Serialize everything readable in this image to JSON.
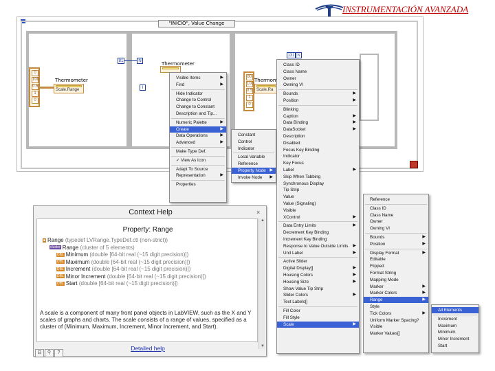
{
  "header": {
    "title": "INSTRUMENTACIÓN AVANZADA"
  },
  "diagram": {
    "case_label": "\"INICIO\", Value Change",
    "thermometer1_label": "Thermometer",
    "thermometer1_node": "Scale.Range",
    "thermometer2_label": "Thermometer",
    "thermometer3_label": "Thermometer",
    "thermometer3_node": "Scale.Ra",
    "array1_values": [
      "0",
      "100",
      "0.5",
      "1",
      "0"
    ],
    "array3_values": [
      "80",
      "100",
      "0.5",
      "1",
      "0"
    ],
    "num_81": "81",
    "num_131": "131"
  },
  "menu1": {
    "items": [
      {
        "label": "Visible Items",
        "arrow": true
      },
      {
        "label": "Find",
        "arrow": true
      },
      {
        "label": "Hide Indicator",
        "arrow": false
      },
      {
        "label": "Change to Control",
        "arrow": false
      },
      {
        "label": "Change to Constant",
        "arrow": false
      },
      {
        "label": "Description and Tip...",
        "arrow": false
      },
      {
        "label": "Numeric Palette",
        "arrow": true
      },
      {
        "label": "Create",
        "arrow": true
      },
      {
        "label": "Data Operations",
        "arrow": true
      },
      {
        "label": "Advanced",
        "arrow": true
      },
      {
        "label": "Make Type Def.",
        "arrow": false
      },
      {
        "label": "✓ View As Icon",
        "arrow": false
      },
      {
        "label": "Adapt To Source",
        "arrow": false
      },
      {
        "label": "Representation",
        "arrow": true
      },
      {
        "label": "Properties",
        "arrow": false
      }
    ]
  },
  "menu2": {
    "items": [
      {
        "label": "Constant",
        "arrow": false
      },
      {
        "label": "Control",
        "arrow": false
      },
      {
        "label": "Indicator",
        "arrow": false
      },
      {
        "label": "Local Variable",
        "arrow": false
      },
      {
        "label": "Reference",
        "arrow": false
      },
      {
        "label": "Property Node",
        "arrow": true
      },
      {
        "label": "Invoke Node",
        "arrow": true
      }
    ]
  },
  "menu3": {
    "items": [
      {
        "label": "Class ID",
        "arrow": false
      },
      {
        "label": "Class Name",
        "arrow": false
      },
      {
        "label": "Owner",
        "arrow": false
      },
      {
        "label": "Owning VI",
        "arrow": false
      },
      {
        "label": "Bounds",
        "arrow": true
      },
      {
        "label": "Position",
        "arrow": true
      },
      {
        "label": "Blinking",
        "arrow": false
      },
      {
        "label": "Caption",
        "arrow": true
      },
      {
        "label": "Data Binding",
        "arrow": true
      },
      {
        "label": "DataSocket",
        "arrow": true
      },
      {
        "label": "Description",
        "arrow": false
      },
      {
        "label": "Disabled",
        "arrow": false
      },
      {
        "label": "Focus Key Binding",
        "arrow": false
      },
      {
        "label": "Indicator",
        "arrow": false
      },
      {
        "label": "Key Focus",
        "arrow": false
      },
      {
        "label": "Label",
        "arrow": true
      },
      {
        "label": "Skip When Tabbing",
        "arrow": false
      },
      {
        "label": "Synchronous Display",
        "arrow": false
      },
      {
        "label": "Tip Strip",
        "arrow": false
      },
      {
        "label": "Value",
        "arrow": false
      },
      {
        "label": "Value (Signaling)",
        "arrow": false
      },
      {
        "label": "Visible",
        "arrow": false
      },
      {
        "label": "XControl",
        "arrow": true
      },
      {
        "label": "Data Entry Limits",
        "arrow": true
      },
      {
        "label": "Decrement Key Binding",
        "arrow": false
      },
      {
        "label": "Increment Key Binding",
        "arrow": false
      },
      {
        "label": "Response to Value Outside Limits",
        "arrow": true
      },
      {
        "label": "Unit Label",
        "arrow": true
      },
      {
        "label": "Active Slider",
        "arrow": false
      },
      {
        "label": "Digital Display[]",
        "arrow": true
      },
      {
        "label": "Housing Colors",
        "arrow": true
      },
      {
        "label": "Housing Size",
        "arrow": true
      },
      {
        "label": "Show Value Tip Strip",
        "arrow": false
      },
      {
        "label": "Slider Colors",
        "arrow": true
      },
      {
        "label": "Text Labels[]",
        "arrow": false
      },
      {
        "label": "Fill Color",
        "arrow": false
      },
      {
        "label": "Fill Style",
        "arrow": false
      },
      {
        "label": "Scale",
        "arrow": true
      }
    ]
  },
  "menu4": {
    "items": [
      {
        "label": "Reference",
        "arrow": false
      },
      {
        "label": "Class ID",
        "arrow": false
      },
      {
        "label": "Class Name",
        "arrow": false
      },
      {
        "label": "Owner",
        "arrow": false
      },
      {
        "label": "Owning VI",
        "arrow": false
      },
      {
        "label": "Bounds",
        "arrow": true
      },
      {
        "label": "Position",
        "arrow": true
      },
      {
        "label": "Display Format",
        "arrow": true
      },
      {
        "label": "Editable",
        "arrow": false
      },
      {
        "label": "Flipped",
        "arrow": false
      },
      {
        "label": "Format String",
        "arrow": false
      },
      {
        "label": "Mapping Mode",
        "arrow": false
      },
      {
        "label": "Marker",
        "arrow": true
      },
      {
        "label": "Marker Colors",
        "arrow": true
      },
      {
        "label": "Range",
        "arrow": true
      },
      {
        "label": "Style",
        "arrow": false
      },
      {
        "label": "Tick Colors",
        "arrow": true
      },
      {
        "label": "Uniform Marker Spacing?",
        "arrow": false
      },
      {
        "label": "Visible",
        "arrow": false
      },
      {
        "label": "Marker Values[]",
        "arrow": false
      }
    ]
  },
  "menu5": {
    "items": [
      {
        "label": "All Elements",
        "arrow": false
      },
      {
        "label": "Increment",
        "arrow": false
      },
      {
        "label": "Maximum",
        "arrow": false
      },
      {
        "label": "Minimum",
        "arrow": false
      },
      {
        "label": "Minor Increment",
        "arrow": false
      },
      {
        "label": "Start",
        "arrow": false
      }
    ]
  },
  "help": {
    "window_title": "Context Help",
    "close": "×",
    "heading": "Property: Range",
    "tree": [
      {
        "tag": "",
        "text": "Range",
        "detail": " (typedef LVRange.TypeDef.ctl (non-strict))"
      },
      {
        "tag": "cluster",
        "text": "Range",
        "detail": " (cluster of 5 elements)"
      },
      {
        "tag": "DBL",
        "text": "Minimum",
        "detail": " (double [64-bit real (~15 digit precision)])"
      },
      {
        "tag": "DBL",
        "text": "Maximum",
        "detail": " (double [64-bit real (~15 digit precision)])"
      },
      {
        "tag": "DBL",
        "text": "Increment",
        "detail": " (double [64-bit real (~15 digit precision)])"
      },
      {
        "tag": "DBL",
        "text": "Minor Increment",
        "detail": " (double [64-bit real (~15 digit precision)])"
      },
      {
        "tag": "DBL",
        "text": "Start",
        "detail": " (double [64-bit real (~15 digit precision)])"
      }
    ],
    "description": "A scale is a component of many front panel objects in LabVIEW, such as the X and Y scales of graphs and charts. The scale consists of a range of values, specified as a cluster of (Minimum, Maximum, Increment, Minor Increment, and Start).",
    "link": "Detailed help",
    "footer_buttons": [
      "⊟",
      "⚲",
      "?"
    ]
  }
}
